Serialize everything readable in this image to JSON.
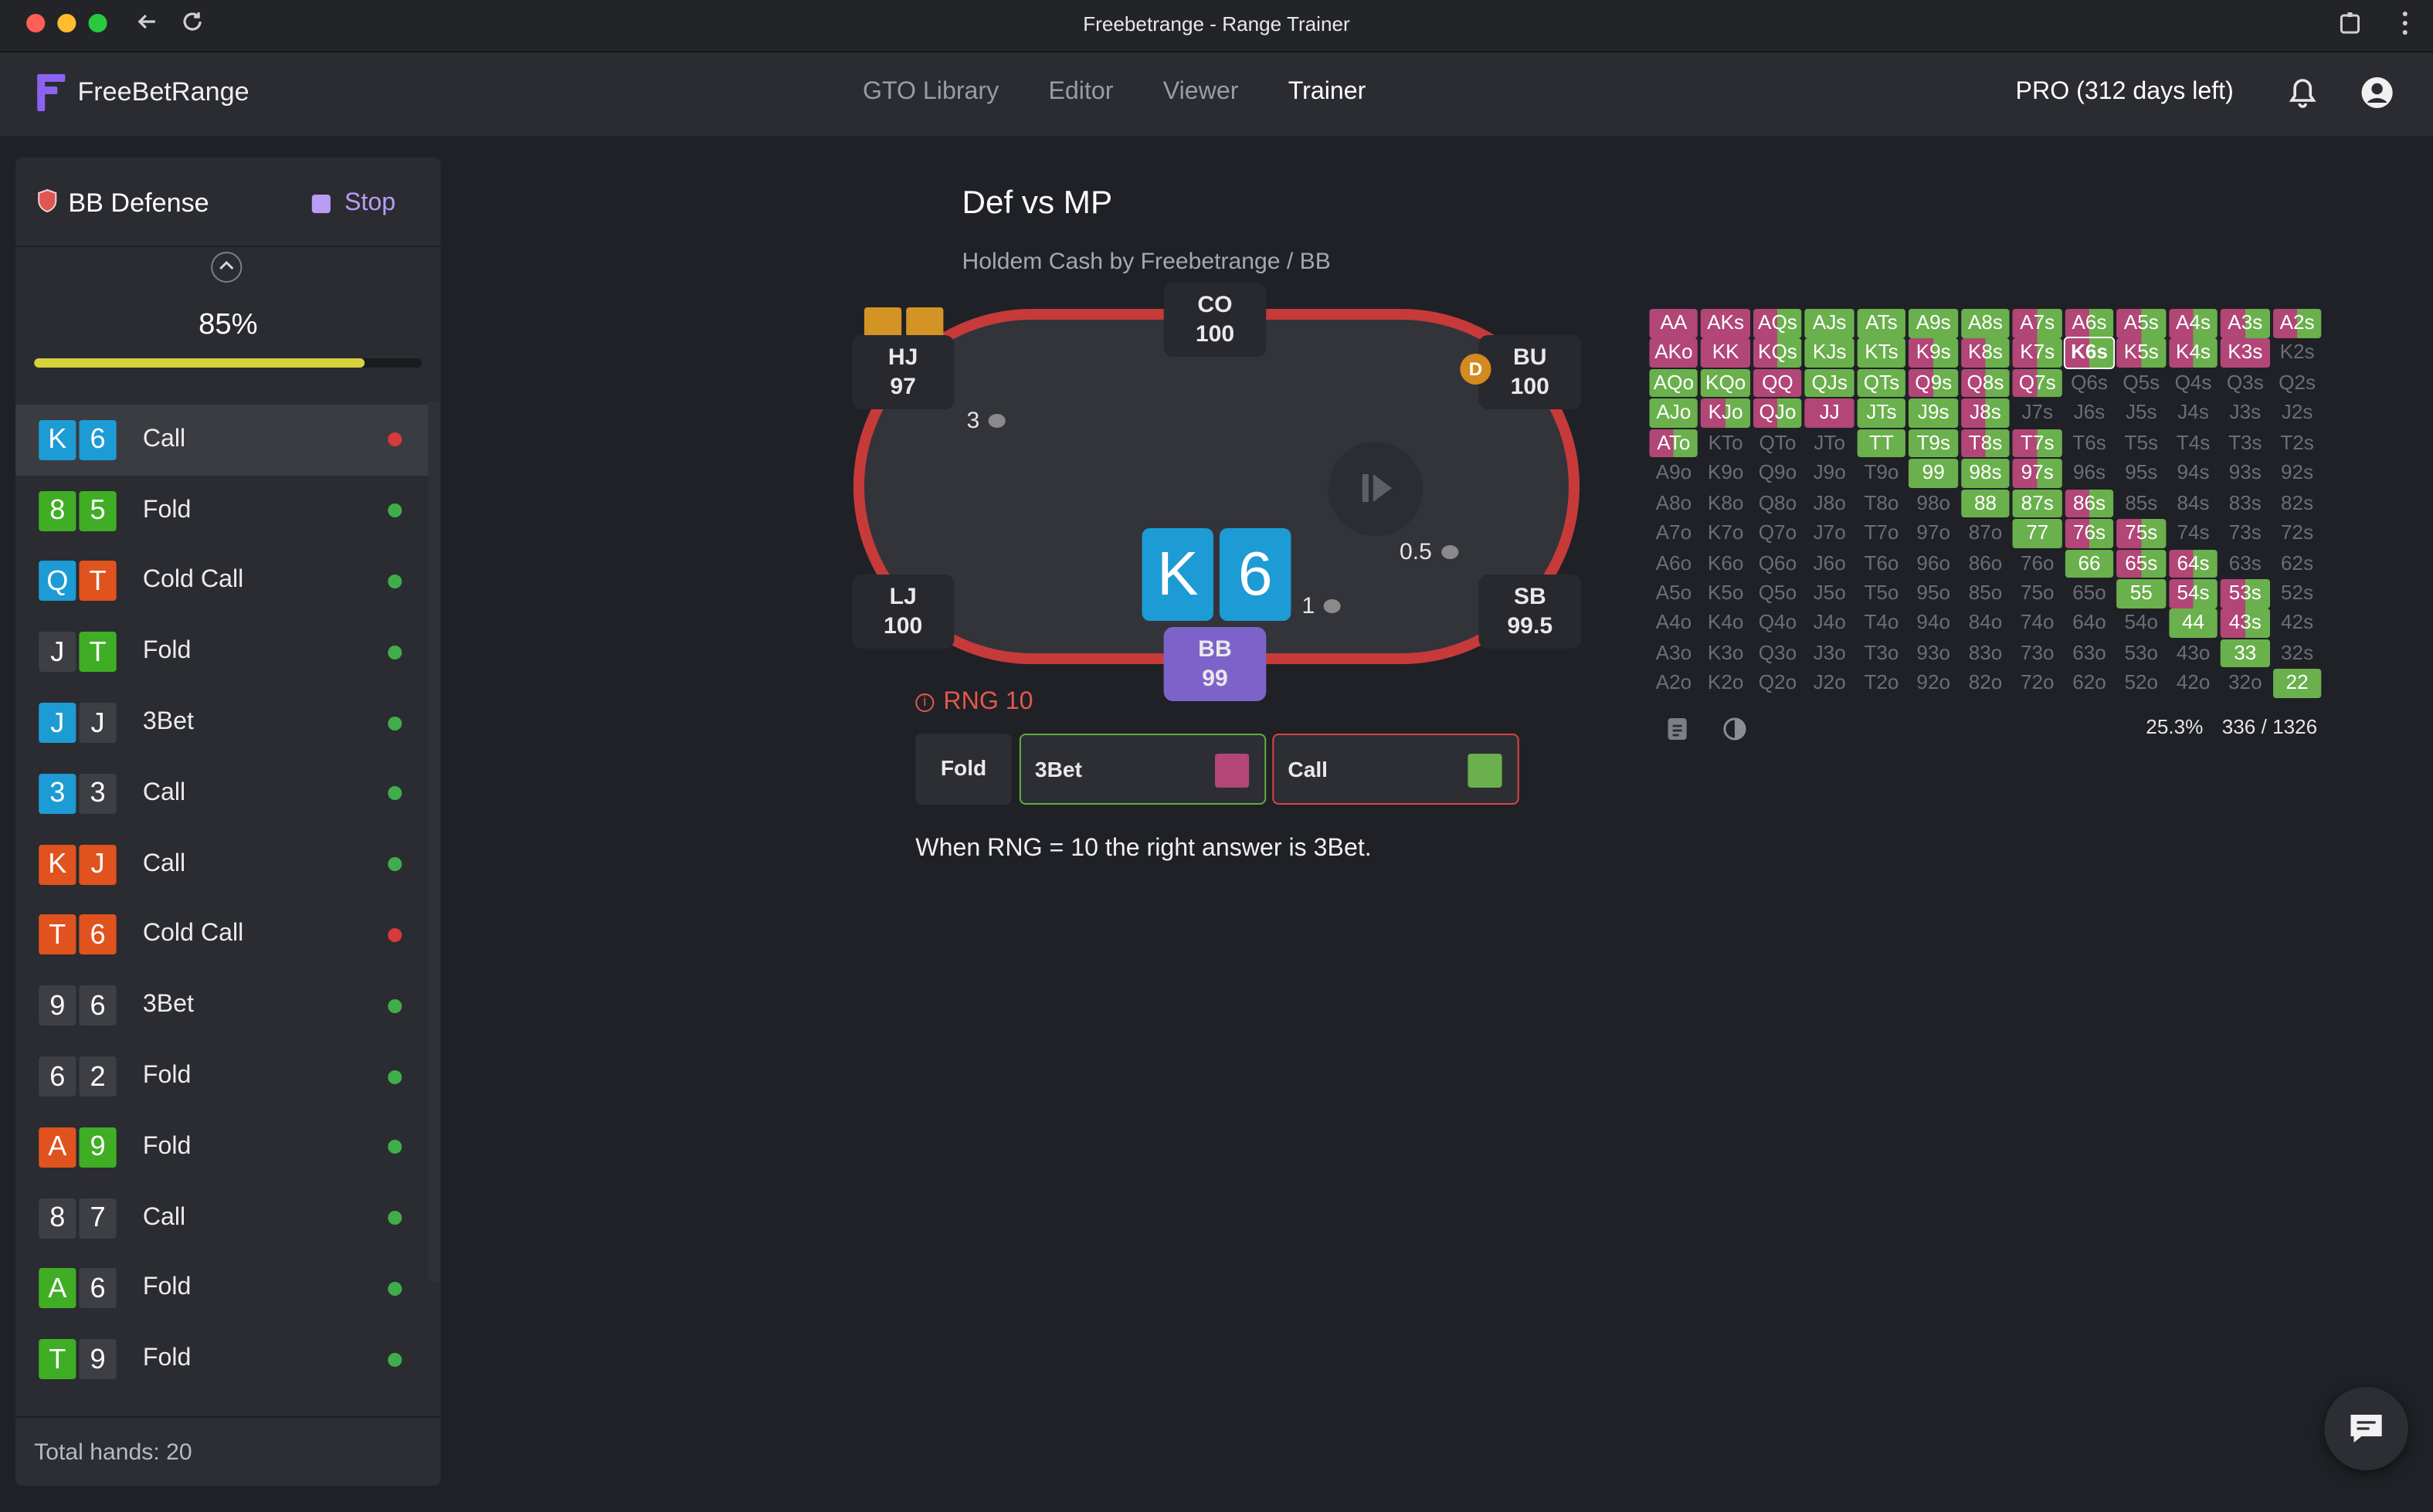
{
  "window": {
    "title": "Freebetrange - Range Trainer"
  },
  "nav": {
    "brand": "FreeBetRange",
    "links": [
      "GTO Library",
      "Editor",
      "Viewer",
      "Trainer"
    ],
    "active": "Trainer",
    "plan": "PRO (312 days left)"
  },
  "sidebar": {
    "title": "BB Defense",
    "stop_label": "Stop",
    "progress": "85%",
    "progress_value": 0.85,
    "hands": [
      {
        "c1": "K",
        "c2": "6",
        "action": "Call",
        "ok": false,
        "selected": true
      },
      {
        "c1": "8",
        "c2": "5",
        "action": "Fold",
        "ok": true
      },
      {
        "c1": "Q",
        "c2": "T",
        "action": "Cold Call",
        "ok": true
      },
      {
        "c1": "J",
        "c2": "T",
        "action": "Fold",
        "ok": true
      },
      {
        "c1": "J",
        "c2": "J",
        "action": "3Bet",
        "ok": true
      },
      {
        "c1": "3",
        "c2": "3",
        "action": "Call",
        "ok": true
      },
      {
        "c1": "K",
        "c2": "J",
        "action": "Call",
        "ok": true
      },
      {
        "c1": "T",
        "c2": "6",
        "action": "Cold Call",
        "ok": false
      },
      {
        "c1": "9",
        "c2": "6",
        "action": "3Bet",
        "ok": true
      },
      {
        "c1": "6",
        "c2": "2",
        "action": "Fold",
        "ok": true
      },
      {
        "c1": "A",
        "c2": "9",
        "action": "Fold",
        "ok": true
      },
      {
        "c1": "8",
        "c2": "7",
        "action": "Call",
        "ok": true
      },
      {
        "c1": "A",
        "c2": "6",
        "action": "Fold",
        "ok": true
      },
      {
        "c1": "T",
        "c2": "9",
        "action": "Fold",
        "ok": true
      }
    ],
    "total": "Total hands: 20"
  },
  "spot": {
    "title": "Def vs MP",
    "subtitle": "Holdem Cash by Freebetrange / BB"
  },
  "table": {
    "seats": {
      "co": {
        "name": "CO",
        "stack": "100"
      },
      "bu": {
        "name": "BU",
        "stack": "100"
      },
      "hj": {
        "name": "HJ",
        "stack": "97"
      },
      "lj": {
        "name": "LJ",
        "stack": "100"
      },
      "sb": {
        "name": "SB",
        "stack": "99.5"
      },
      "bb": {
        "name": "BB",
        "stack": "99"
      }
    },
    "bets": {
      "hj": "3",
      "sb": "0.5",
      "bb": "1"
    },
    "dealer": "D",
    "hero_cards": [
      "K",
      "6"
    ]
  },
  "rng": "RNG 10",
  "actions": [
    {
      "label": "Fold"
    },
    {
      "label": "3Bet",
      "color": "#b24676"
    },
    {
      "label": "Call",
      "color": "#6ab04c"
    }
  ],
  "answer": "When RNG = 10 the right answer is 3Bet.",
  "range": {
    "grid": [
      [
        [
          "AA",
          "p"
        ],
        [
          "AKs",
          "p"
        ],
        [
          "AQs",
          "s"
        ],
        [
          "AJs",
          "g"
        ],
        [
          "ATs",
          "g"
        ],
        [
          "A9s",
          "g"
        ],
        [
          "A8s",
          "g"
        ],
        [
          "A7s",
          "s"
        ],
        [
          "A6s",
          "s"
        ],
        [
          "A5s",
          "s"
        ],
        [
          "A4s",
          "s"
        ],
        [
          "A3s",
          "s"
        ],
        [
          "A2s",
          "s"
        ]
      ],
      [
        [
          "AKo",
          "p"
        ],
        [
          "KK",
          "p"
        ],
        [
          "KQs",
          "s"
        ],
        [
          "KJs",
          "g"
        ],
        [
          "KTs",
          "g"
        ],
        [
          "K9s",
          "s"
        ],
        [
          "K8s",
          "s"
        ],
        [
          "K7s",
          "s"
        ],
        [
          "K6s",
          "sel"
        ],
        [
          "K5s",
          "s"
        ],
        [
          "K4s",
          "s"
        ],
        [
          "K3s",
          "p"
        ],
        [
          "K2s",
          ""
        ]
      ],
      [
        [
          "AQo",
          "g"
        ],
        [
          "KQo",
          "g"
        ],
        [
          "QQ",
          "p"
        ],
        [
          "QJs",
          "g"
        ],
        [
          "QTs",
          "g"
        ],
        [
          "Q9s",
          "s"
        ],
        [
          "Q8s",
          "s"
        ],
        [
          "Q7s",
          "s"
        ],
        [
          "Q6s",
          ""
        ],
        [
          "Q5s",
          ""
        ],
        [
          "Q4s",
          ""
        ],
        [
          "Q3s",
          ""
        ],
        [
          "Q2s",
          ""
        ]
      ],
      [
        [
          "AJo",
          "g"
        ],
        [
          "KJo",
          "s"
        ],
        [
          "QJo",
          "s"
        ],
        [
          "JJ",
          "p"
        ],
        [
          "JTs",
          "g"
        ],
        [
          "J9s",
          "g"
        ],
        [
          "J8s",
          "s"
        ],
        [
          "J7s",
          ""
        ],
        [
          "J6s",
          ""
        ],
        [
          "J5s",
          ""
        ],
        [
          "J4s",
          ""
        ],
        [
          "J3s",
          ""
        ],
        [
          "J2s",
          ""
        ]
      ],
      [
        [
          "ATo",
          "s"
        ],
        [
          "KTo",
          ""
        ],
        [
          "QTo",
          ""
        ],
        [
          "JTo",
          ""
        ],
        [
          "TT",
          "g"
        ],
        [
          "T9s",
          "g"
        ],
        [
          "T8s",
          "s"
        ],
        [
          "T7s",
          "s"
        ],
        [
          "T6s",
          ""
        ],
        [
          "T5s",
          ""
        ],
        [
          "T4s",
          ""
        ],
        [
          "T3s",
          ""
        ],
        [
          "T2s",
          ""
        ]
      ],
      [
        [
          "A9o",
          ""
        ],
        [
          "K9o",
          ""
        ],
        [
          "Q9o",
          ""
        ],
        [
          "J9o",
          ""
        ],
        [
          "T9o",
          ""
        ],
        [
          "99",
          "g"
        ],
        [
          "98s",
          "g"
        ],
        [
          "97s",
          "s"
        ],
        [
          "96s",
          ""
        ],
        [
          "95s",
          ""
        ],
        [
          "94s",
          ""
        ],
        [
          "93s",
          ""
        ],
        [
          "92s",
          ""
        ]
      ],
      [
        [
          "A8o",
          ""
        ],
        [
          "K8o",
          ""
        ],
        [
          "Q8o",
          ""
        ],
        [
          "J8o",
          ""
        ],
        [
          "T8o",
          ""
        ],
        [
          "98o",
          ""
        ],
        [
          "88",
          "g"
        ],
        [
          "87s",
          "g"
        ],
        [
          "86s",
          "s"
        ],
        [
          "85s",
          ""
        ],
        [
          "84s",
          ""
        ],
        [
          "83s",
          ""
        ],
        [
          "82s",
          ""
        ]
      ],
      [
        [
          "A7o",
          ""
        ],
        [
          "K7o",
          ""
        ],
        [
          "Q7o",
          ""
        ],
        [
          "J7o",
          ""
        ],
        [
          "T7o",
          ""
        ],
        [
          "97o",
          ""
        ],
        [
          "87o",
          ""
        ],
        [
          "77",
          "g"
        ],
        [
          "76s",
          "s"
        ],
        [
          "75s",
          "s"
        ],
        [
          "74s",
          ""
        ],
        [
          "73s",
          ""
        ],
        [
          "72s",
          ""
        ]
      ],
      [
        [
          "A6o",
          ""
        ],
        [
          "K6o",
          ""
        ],
        [
          "Q6o",
          ""
        ],
        [
          "J6o",
          ""
        ],
        [
          "T6o",
          ""
        ],
        [
          "96o",
          ""
        ],
        [
          "86o",
          ""
        ],
        [
          "76o",
          ""
        ],
        [
          "66",
          "g"
        ],
        [
          "65s",
          "s"
        ],
        [
          "64s",
          "s"
        ],
        [
          "63s",
          ""
        ],
        [
          "62s",
          ""
        ]
      ],
      [
        [
          "A5o",
          ""
        ],
        [
          "K5o",
          ""
        ],
        [
          "Q5o",
          ""
        ],
        [
          "J5o",
          ""
        ],
        [
          "T5o",
          ""
        ],
        [
          "95o",
          ""
        ],
        [
          "85o",
          ""
        ],
        [
          "75o",
          ""
        ],
        [
          "65o",
          ""
        ],
        [
          "55",
          "g"
        ],
        [
          "54s",
          "s"
        ],
        [
          "53s",
          "s"
        ],
        [
          "52s",
          ""
        ]
      ],
      [
        [
          "A4o",
          ""
        ],
        [
          "K4o",
          ""
        ],
        [
          "Q4o",
          ""
        ],
        [
          "J4o",
          ""
        ],
        [
          "T4o",
          ""
        ],
        [
          "94o",
          ""
        ],
        [
          "84o",
          ""
        ],
        [
          "74o",
          ""
        ],
        [
          "64o",
          ""
        ],
        [
          "54o",
          ""
        ],
        [
          "44",
          "g"
        ],
        [
          "43s",
          "s"
        ],
        [
          "42s",
          ""
        ]
      ],
      [
        [
          "A3o",
          ""
        ],
        [
          "K3o",
          ""
        ],
        [
          "Q3o",
          ""
        ],
        [
          "J3o",
          ""
        ],
        [
          "T3o",
          ""
        ],
        [
          "93o",
          ""
        ],
        [
          "83o",
          ""
        ],
        [
          "73o",
          ""
        ],
        [
          "63o",
          ""
        ],
        [
          "53o",
          ""
        ],
        [
          "43o",
          ""
        ],
        [
          "33",
          "g"
        ],
        [
          "32s",
          ""
        ]
      ],
      [
        [
          "A2o",
          ""
        ],
        [
          "K2o",
          ""
        ],
        [
          "Q2o",
          ""
        ],
        [
          "J2o",
          ""
        ],
        [
          "T2o",
          ""
        ],
        [
          "92o",
          ""
        ],
        [
          "82o",
          ""
        ],
        [
          "72o",
          ""
        ],
        [
          "62o",
          ""
        ],
        [
          "52o",
          ""
        ],
        [
          "42o",
          ""
        ],
        [
          "32o",
          ""
        ],
        [
          "22",
          "g"
        ]
      ]
    ],
    "percent": "25.3%",
    "combos": "336 / 1326"
  },
  "colors": {
    "raise": "#b24676",
    "call": "#6ab04c",
    "accent": "#8b63f0",
    "table_rail": "#c73a3a",
    "card_blue": "#1d9bd4",
    "card_red": "#e0531f",
    "card_green": "#3fae24",
    "card_gray": "#3d3f45"
  },
  "icons": [
    "back-arrow-icon",
    "reload-icon",
    "extensions-icon",
    "kebab-icon",
    "bell-icon",
    "account-icon",
    "shield-icon",
    "chevron-up-icon",
    "play-next-icon",
    "info-icon",
    "notes-icon",
    "contrast-icon",
    "chat-icon"
  ]
}
